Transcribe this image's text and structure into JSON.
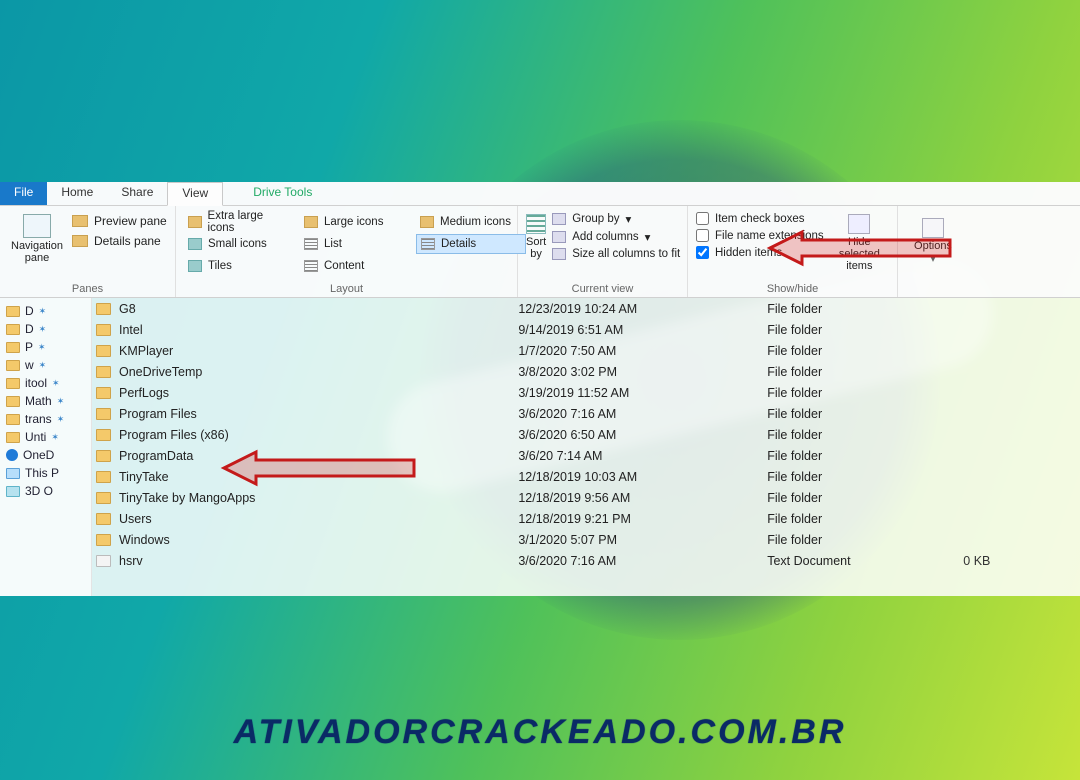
{
  "tabs": {
    "file": "File",
    "home": "Home",
    "share": "Share",
    "view": "View",
    "drive_tools": "Drive Tools"
  },
  "panes": {
    "navpane": "Navigation\npane",
    "preview": "Preview pane",
    "details": "Details pane",
    "title": "Panes"
  },
  "layout": {
    "xl": "Extra large icons",
    "lg": "Large icons",
    "md": "Medium icons",
    "sm": "Small icons",
    "list": "List",
    "details": "Details",
    "tiles": "Tiles",
    "content": "Content",
    "title": "Layout"
  },
  "sort": {
    "label": "Sort\nby"
  },
  "curview": {
    "group": "Group by",
    "addcols": "Add columns",
    "sizeall": "Size all columns to fit",
    "title": "Current view"
  },
  "showhide": {
    "itemchk": "Item check boxes",
    "ext": "File name extensions",
    "hidden": "Hidden items",
    "hidesel": "Hide selected\nitems",
    "title": "Show/hide"
  },
  "options": "Options",
  "sidebar": {
    "items": [
      {
        "label": "D"
      },
      {
        "label": "D"
      },
      {
        "label": "P"
      },
      {
        "label": "w"
      },
      {
        "label": "itool"
      },
      {
        "label": "Math"
      },
      {
        "label": "trans"
      },
      {
        "label": "Unti"
      },
      {
        "label": "OneD",
        "kind": "od"
      },
      {
        "label": "This P",
        "kind": "pc"
      },
      {
        "label": "3D O",
        "kind": "obj"
      }
    ]
  },
  "files": [
    {
      "name": "G8",
      "date": "12/23/2019 10:24 AM",
      "type": "File folder",
      "size": ""
    },
    {
      "name": "Intel",
      "date": "9/14/2019 6:51 AM",
      "type": "File folder",
      "size": ""
    },
    {
      "name": "KMPlayer",
      "date": "1/7/2020 7:50 AM",
      "type": "File folder",
      "size": ""
    },
    {
      "name": "OneDriveTemp",
      "date": "3/8/2020 3:02 PM",
      "type": "File folder",
      "size": ""
    },
    {
      "name": "PerfLogs",
      "date": "3/19/2019 11:52 AM",
      "type": "File folder",
      "size": ""
    },
    {
      "name": "Program Files",
      "date": "3/6/2020 7:16 AM",
      "type": "File folder",
      "size": ""
    },
    {
      "name": "Program Files (x86)",
      "date": "3/6/2020 6:50 AM",
      "type": "File folder",
      "size": ""
    },
    {
      "name": "ProgramData",
      "date": "3/6/20 7:14 AM",
      "type": "File folder",
      "size": ""
    },
    {
      "name": "TinyTake",
      "date": "12/18/2019 10:03 AM",
      "type": "File folder",
      "size": ""
    },
    {
      "name": "TinyTake by MangoApps",
      "date": "12/18/2019 9:56 AM",
      "type": "File folder",
      "size": ""
    },
    {
      "name": "Users",
      "date": "12/18/2019 9:21 PM",
      "type": "File folder",
      "size": ""
    },
    {
      "name": "Windows",
      "date": "3/1/2020 5:07 PM",
      "type": "File folder",
      "size": ""
    },
    {
      "name": "hsrv",
      "date": "3/6/2020 7:16 AM",
      "type": "Text Document",
      "size": "0 KB",
      "icon": "txt"
    }
  ],
  "watermark": "ATIVADORCRACKEADO.COM.BR"
}
